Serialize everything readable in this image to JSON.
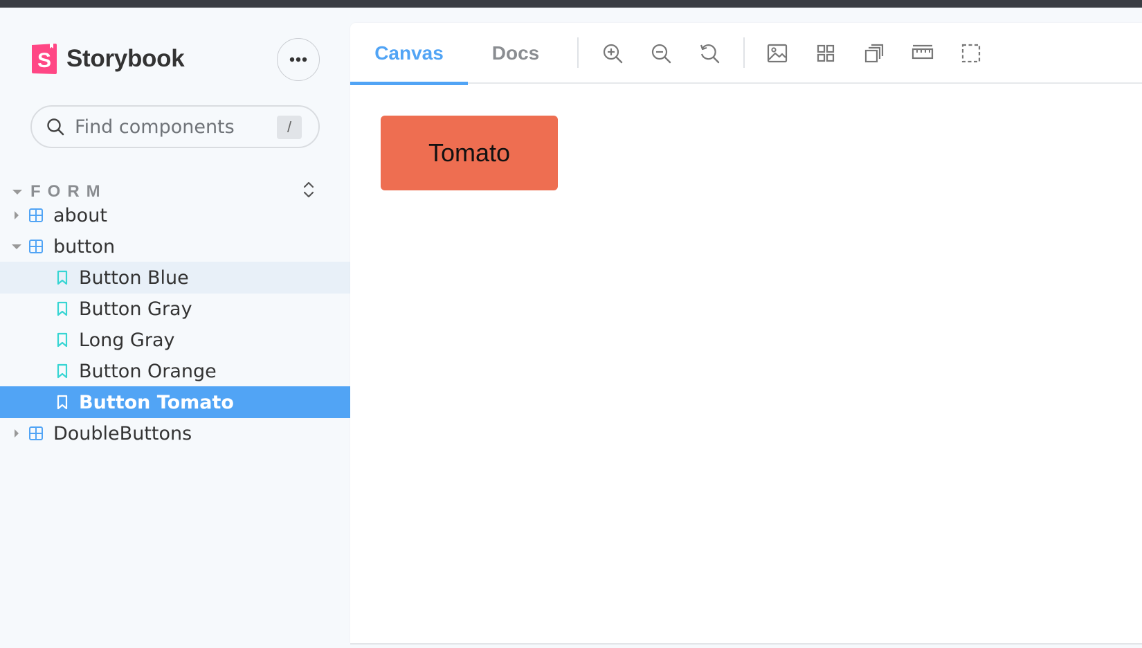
{
  "brand": {
    "name": "Storybook",
    "accent": "#ff4785"
  },
  "search": {
    "placeholder": "Find components",
    "shortcut": "/"
  },
  "sidebar": {
    "section_title": "FORM",
    "components": [
      {
        "label": "about",
        "expanded": false
      },
      {
        "label": "button",
        "expanded": true
      },
      {
        "label": "DoubleButtons",
        "expanded": false
      }
    ],
    "stories": [
      {
        "label": "Button Blue",
        "state": "hover"
      },
      {
        "label": "Button Gray",
        "state": "normal"
      },
      {
        "label": "Long Gray",
        "state": "normal"
      },
      {
        "label": "Button Orange",
        "state": "normal"
      },
      {
        "label": "Button Tomato",
        "state": "selected"
      }
    ]
  },
  "toolbar": {
    "tabs": [
      {
        "label": "Canvas",
        "active": true
      },
      {
        "label": "Docs",
        "active": false
      }
    ],
    "tools": [
      "zoom-in-icon",
      "zoom-out-icon",
      "zoom-reset-icon",
      "background-icon",
      "grid-icon",
      "viewport-icon",
      "measure-icon",
      "outline-icon"
    ]
  },
  "preview": {
    "button_label": "Tomato",
    "button_color": "#ee6e51"
  },
  "colors": {
    "accent": "#51a4f5",
    "selected_bg": "#51a4f5",
    "sidebar_bg": "#f6f9fc",
    "component_icon": "#51a4f5",
    "story_icon": "#37d5d3"
  }
}
